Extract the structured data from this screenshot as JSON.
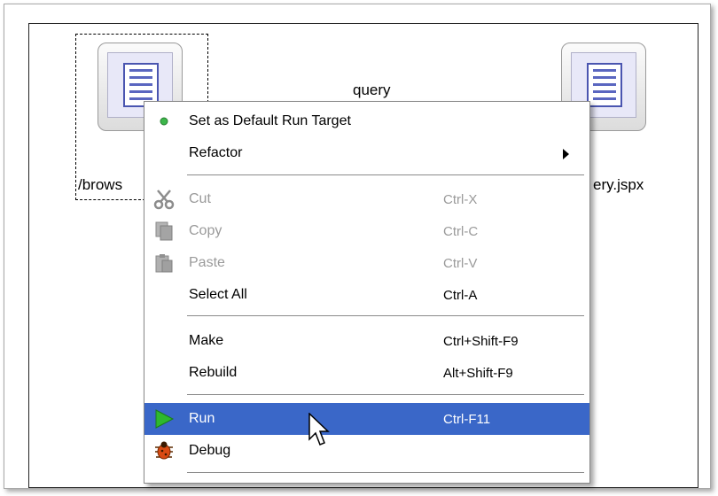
{
  "canvas": {
    "nodes": [
      {
        "label": "/brows"
      },
      {
        "label": "query"
      },
      {
        "label": "ery.jspx"
      }
    ]
  },
  "context_menu": {
    "items": [
      {
        "label": "Set as Default Run Target",
        "icon": "green-dot-icon"
      },
      {
        "label": "Refactor",
        "submenu": true
      },
      {
        "label": "Cut",
        "shortcut": "Ctrl-X",
        "icon": "scissors-icon",
        "enabled": false
      },
      {
        "label": "Copy",
        "shortcut": "Ctrl-C",
        "icon": "copy-icon",
        "enabled": false
      },
      {
        "label": "Paste",
        "shortcut": "Ctrl-V",
        "icon": "paste-icon",
        "enabled": false
      },
      {
        "label": "Select All",
        "shortcut": "Ctrl-A"
      },
      {
        "label": "Make",
        "shortcut": "Ctrl+Shift-F9"
      },
      {
        "label": "Rebuild",
        "shortcut": "Alt+Shift-F9"
      },
      {
        "label": "Run",
        "shortcut": "Ctrl-F11",
        "icon": "run-icon",
        "highlighted": true
      },
      {
        "label": "Debug",
        "icon": "bug-icon"
      }
    ]
  },
  "colors": {
    "highlight": "#3a67c8",
    "disabled_text": "#9a9a9a",
    "run_green": "#2eb82e"
  }
}
